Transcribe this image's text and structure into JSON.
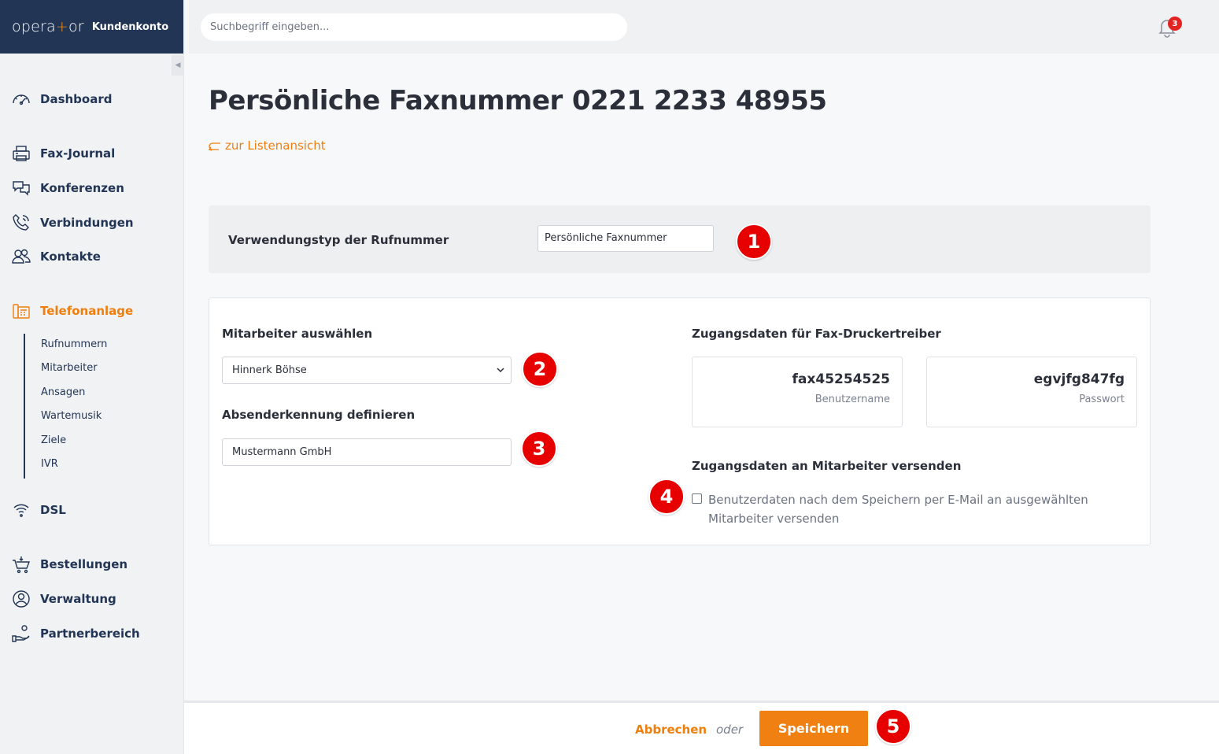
{
  "brand": {
    "logo_pre": "opera",
    "logo_plus": "+",
    "logo_post": "or",
    "subtitle": "Kundenkonto"
  },
  "search": {
    "placeholder": "Suchbegriff eingeben..."
  },
  "notifications": {
    "count": "3"
  },
  "sidebar": {
    "items": [
      {
        "label": "Dashboard",
        "icon": "dashboard-gauge-icon"
      },
      {
        "label": "Fax-Journal",
        "icon": "fax-printer-icon"
      },
      {
        "label": "Konferenzen",
        "icon": "chat-bubbles-icon"
      },
      {
        "label": "Verbindungen",
        "icon": "phone-icon"
      },
      {
        "label": "Kontakte",
        "icon": "contacts-icon"
      },
      {
        "label": "Telefonanlage",
        "icon": "phone-system-icon",
        "active": true
      },
      {
        "label": "DSL",
        "icon": "wifi-icon"
      },
      {
        "label": "Bestellungen",
        "icon": "cart-icon"
      },
      {
        "label": "Verwaltung",
        "icon": "user-circle-icon"
      },
      {
        "label": "Partnerbereich",
        "icon": "partner-hand-icon"
      }
    ],
    "subitems": [
      "Rufnummern",
      "Mitarbeiter",
      "Ansagen",
      "Wartemusik",
      "Ziele",
      "IVR"
    ]
  },
  "page": {
    "title": "Persönliche Faxnummer",
    "number": "0221 2233 48955",
    "back_link": "zur Listenansicht"
  },
  "usage": {
    "label": "Verwendungstyp der Rufnummer",
    "value": "Persönliche Faxnummer"
  },
  "form": {
    "employee_heading": "Mitarbeiter auswählen",
    "employee_value": "Hinnerk Böhse",
    "sender_heading": "Absenderkennung definieren",
    "sender_value": "Mustermann GmbH",
    "credentials_heading": "Zugangsdaten für Fax-Druckertreiber",
    "username": "fax45254525",
    "username_caption": "Benutzername",
    "password": "egvjfg847fg",
    "password_caption": "Passwort",
    "send_heading": "Zugangsdaten an Mitarbeiter versenden",
    "send_checkbox_label": "Benutzerdaten nach dem Speichern per E-Mail an ausgewählten Mitarbeiter versenden",
    "send_checked": false
  },
  "markers": [
    "1",
    "2",
    "3",
    "4",
    "5"
  ],
  "footer": {
    "cancel": "Abbrechen",
    "or": "oder",
    "save": "Speichern"
  },
  "colors": {
    "brand_navy": "#223555",
    "accent_orange": "#ee7f0e",
    "marker_red": "#e60000"
  }
}
